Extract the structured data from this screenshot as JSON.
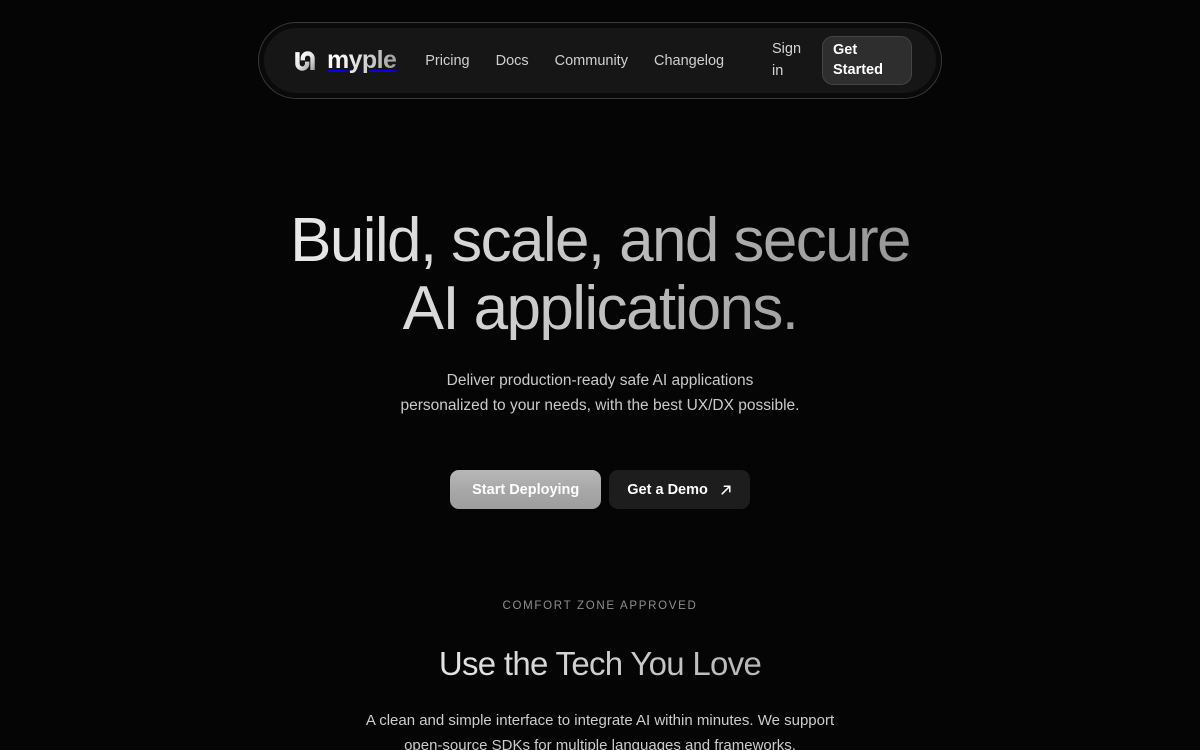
{
  "brand": {
    "name": "myple",
    "mark_icon": "myple-logo-mark"
  },
  "nav": {
    "links": [
      {
        "label": "Pricing"
      },
      {
        "label": "Docs"
      },
      {
        "label": "Community"
      },
      {
        "label": "Changelog"
      }
    ],
    "sign_in_label": "Sign in",
    "get_started_label": "Get Started"
  },
  "hero": {
    "title_line1": "Build, scale, and secure",
    "title_line2": "AI applications.",
    "subtitle_line1": "Deliver production-ready safe AI applications",
    "subtitle_line2": "personalized to your needs, with the best UX/DX possible.",
    "primary_cta": "Start Deploying",
    "secondary_cta": "Get a Demo",
    "secondary_cta_icon": "arrow-up-right-icon"
  },
  "tech_section": {
    "eyebrow": "COMFORT ZONE APPROVED",
    "title": "Use the Tech You Love",
    "body_line1": "A clean and simple interface to integrate AI within minutes. We support",
    "body_line2": "open-source SDKs for multiple languages and frameworks."
  },
  "colors": {
    "background": "#050505",
    "nav_outer": "#0a0a0a",
    "nav_inner": "#161616",
    "nav_border": "#3a3a3a",
    "primary_button": "#b0b0b0",
    "secondary_button": "#1d1d1d",
    "text_primary": "#ffffff",
    "text_muted": "#8e8e8e"
  }
}
